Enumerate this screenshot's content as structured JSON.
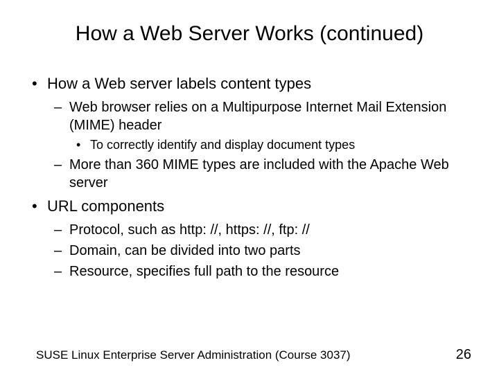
{
  "title": "How a Web Server Works (continued)",
  "bullets": {
    "b1": "How a Web server labels content types",
    "b1_1": "Web browser relies on a Multipurpose Internet Mail Extension (MIME) header",
    "b1_1_1": "To correctly identify and display document types",
    "b1_2": "More than 360 MIME types are included with the Apache Web server",
    "b2": "URL components",
    "b2_1": "Protocol, such as http: //, https: //, ftp: //",
    "b2_2": "Domain, can be divided into two parts",
    "b2_3": "Resource, specifies full path to the resource"
  },
  "footer": {
    "text": "SUSE Linux Enterprise Server Administration (Course 3037)",
    "page": "26"
  }
}
